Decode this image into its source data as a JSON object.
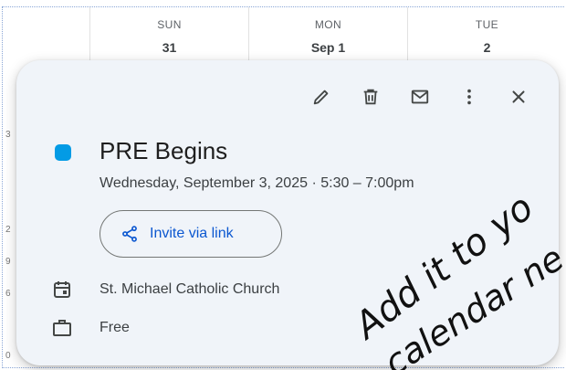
{
  "calendar_header": {
    "days": [
      {
        "dow": "SUN",
        "date": "31"
      },
      {
        "dow": "MON",
        "date": "Sep 1"
      },
      {
        "dow": "TUE",
        "date": "2"
      }
    ]
  },
  "side_marks": [
    "3",
    "2",
    "9",
    "6",
    "0"
  ],
  "toolbar": {
    "edit_icon": "pencil-icon",
    "delete_icon": "trash-icon",
    "email_icon": "mail-icon",
    "more_icon": "more-vert-icon",
    "close_icon": "close-icon"
  },
  "event": {
    "color": "#039be5",
    "title": "PRE Begins",
    "when": "Wednesday, September 3, 2025  ·  5:30 – 7:00pm",
    "invite_label": "Invite via link",
    "calendar_name": "St. Michael Catholic Church",
    "status": "Free"
  },
  "annotation": {
    "line1": "Add it to yo",
    "line2": "calendar ne"
  },
  "colors": {
    "card_bg": "#f0f4f9",
    "link_blue": "#0b57d0",
    "event_dot": "#039be5"
  }
}
